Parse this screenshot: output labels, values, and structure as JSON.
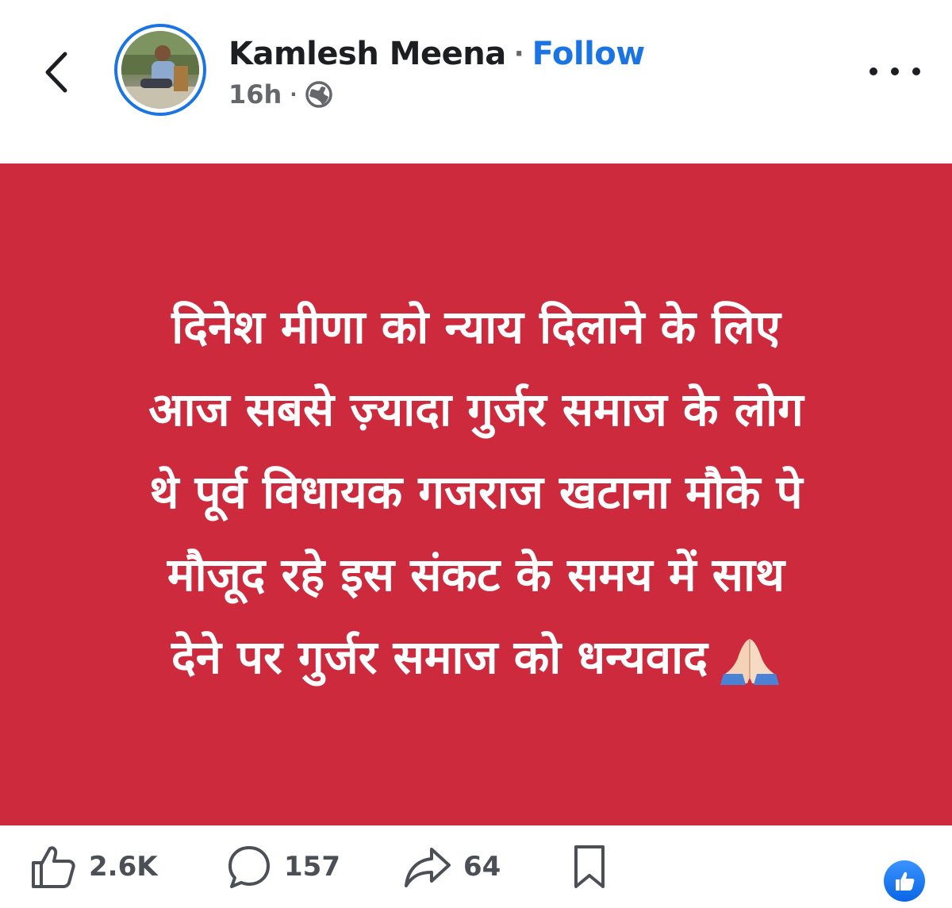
{
  "header": {
    "back_icon": "chevron-left-icon",
    "author_name": "Kamlesh Meena",
    "separator": "·",
    "follow_label": "Follow",
    "timestamp": "16h",
    "meta_separator": "·",
    "privacy_icon": "globe-icon",
    "more_icon": "more-horizontal-icon"
  },
  "post": {
    "background_color": "#cd2a3d",
    "lines": [
      "दिनेश मीणा को न्याय दिलाने के लिए",
      "आज सबसे ज़्यादा गुर्जर समाज के लोग",
      "थे पूर्व विधायक गजराज खटाना मौके पे",
      "मौजूद रहे  इस संकट के समय में साथ",
      "देने पर गुर्जर समाज को धन्यवाद"
    ],
    "emoji": "🙏🏻"
  },
  "actions": {
    "like_count": "2.6K",
    "comment_count": "157",
    "share_count": "64",
    "like_icon": "thumbs-up-icon",
    "comment_icon": "comment-bubble-icon",
    "share_icon": "share-arrow-icon",
    "save_icon": "bookmark-icon",
    "reaction_icon": "like-reaction-icon"
  },
  "colors": {
    "accent": "#1b74e4",
    "text_primary": "#1c1e21",
    "text_secondary": "#65676b"
  }
}
